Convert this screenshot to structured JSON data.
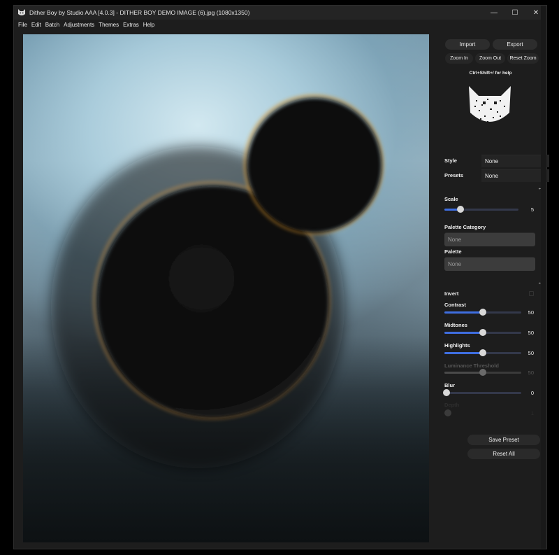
{
  "window": {
    "title": "Dither Boy by Studio AAA [4.0.3] - DITHER BOY DEMO IMAGE (6).jpg (1080x1350)",
    "controls": [
      "—",
      "☐",
      "✕"
    ]
  },
  "menu": [
    "File",
    "Edit",
    "Batch",
    "Adjustments",
    "Themes",
    "Extras",
    "Help"
  ],
  "panel": {
    "import_label": "Import",
    "export_label": "Export",
    "zoom_in_label": "Zoom In",
    "zoom_out_label": "Zoom Out",
    "reset_zoom_label": "Reset Zoom",
    "help_text": "Ctrl+Shift+/ for help",
    "style_label": "Style",
    "style_value": "None",
    "presets_label": "Presets",
    "presets_value": "None",
    "scale": {
      "label": "Scale",
      "value": "5",
      "fraction": 0.22
    },
    "palette_category_label": "Palette Category",
    "palette_category_value": "None",
    "palette_label": "Palette",
    "palette_value": "None",
    "invert_label": "Invert",
    "contrast": {
      "label": "Contrast",
      "value": "50",
      "fraction": 0.5
    },
    "midtones": {
      "label": "Midtones",
      "value": "50",
      "fraction": 0.5
    },
    "highlights": {
      "label": "Highlights",
      "value": "50",
      "fraction": 0.5
    },
    "luminance": {
      "label": "Luminance Threshold",
      "value": "50",
      "fraction": 0.5
    },
    "blur": {
      "label": "Blur",
      "value": "0",
      "fraction": 0.0
    },
    "ghost_label": "Depth",
    "ghost_value": "1",
    "save_preset_label": "Save Preset",
    "reset_all_label": "Reset All"
  },
  "colors": {
    "accent": "#3f6ee0",
    "window_bg": "#1d1d1d",
    "button_bg": "#2d2d2d"
  },
  "icons": {
    "app": "cat-icon",
    "swap": "swap-horizontal-icon"
  }
}
